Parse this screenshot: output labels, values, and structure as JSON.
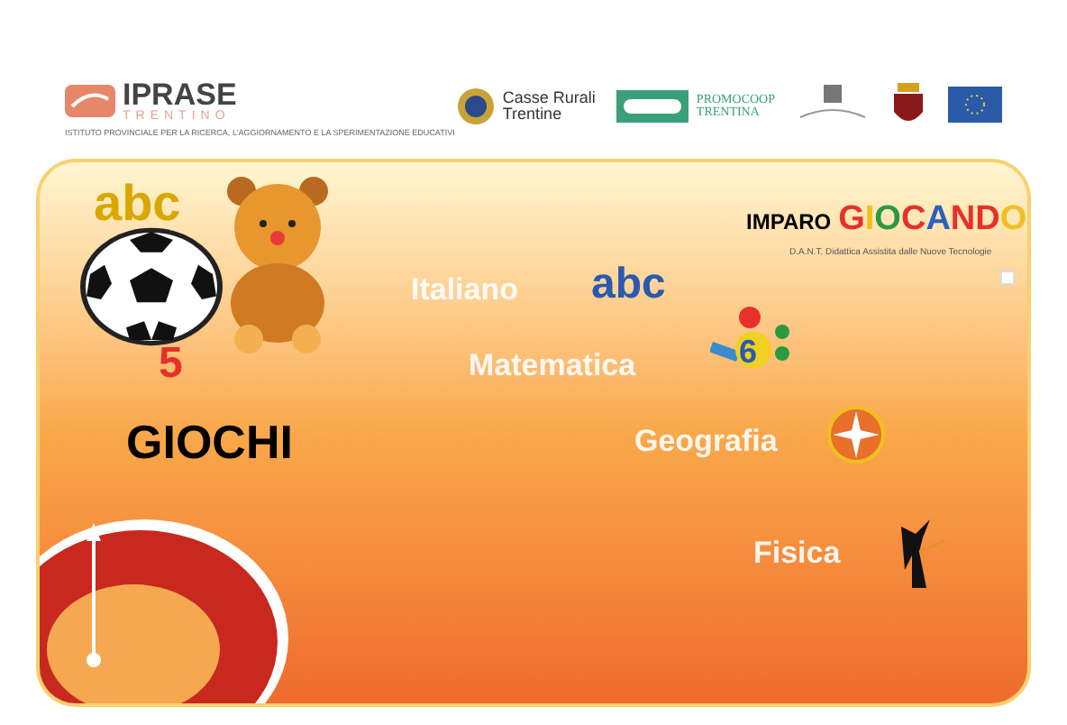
{
  "header": {
    "logo": {
      "name": "IPRASE",
      "sub": "TRENTINO",
      "tagline": "ISTITUTO PROVINCIALE PER LA RICERCA, L'AGGIORNAMENTO E LA SPERIMENTAZIONE EDUCATIVI"
    },
    "sponsors": [
      {
        "kind": "seal",
        "lines": [
          "Casse Rurali",
          "Trentine"
        ]
      },
      {
        "kind": "banner",
        "lines": [
          "PROMOCOOP",
          "TRENTINA"
        ]
      },
      {
        "kind": "crest"
      },
      {
        "kind": "shield"
      },
      {
        "kind": "flag"
      }
    ]
  },
  "title": {
    "word1": "IMPARO",
    "word2": "GIOCANDO",
    "subtitle": "D.A.N.T. Didattica Assistita dalle Nuove Tecnologie"
  },
  "games": {
    "label": "GIOCHI",
    "count": "5",
    "decor": "abc"
  },
  "subjects": [
    {
      "label": "Italiano",
      "kind": "letters",
      "icon_text": "abc"
    },
    {
      "label": "Matematica",
      "kind": "numbers",
      "icon_text": "6"
    },
    {
      "label": "Geografia",
      "kind": "compass"
    },
    {
      "label": "Fisica",
      "kind": "figure"
    }
  ]
}
